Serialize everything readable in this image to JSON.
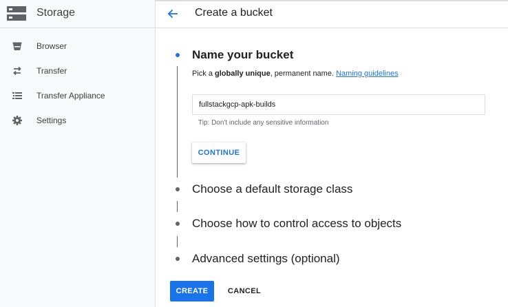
{
  "sidebar": {
    "title": "Storage",
    "items": [
      {
        "label": "Browser",
        "icon": "bucket-icon"
      },
      {
        "label": "Transfer",
        "icon": "transfer-arrows-icon"
      },
      {
        "label": "Transfer Appliance",
        "icon": "transfer-appliance-icon"
      },
      {
        "label": "Settings",
        "icon": "gear-icon"
      }
    ]
  },
  "header": {
    "title": "Create a bucket"
  },
  "steps": [
    {
      "title": "Name your bucket",
      "active": true
    },
    {
      "title": "Choose a default storage class",
      "active": false
    },
    {
      "title": "Choose how to control access to objects",
      "active": false
    },
    {
      "title": "Advanced settings (optional)",
      "active": false
    }
  ],
  "name_step": {
    "desc_prefix": "Pick a ",
    "desc_bold": "globally unique",
    "desc_suffix": ", permanent name.",
    "guidelines_link": "Naming guidelines",
    "input_value": "fullstackgcp-apk-builds",
    "tip": "Tip: Don't include any sensitive information",
    "continue_label": "CONTINUE"
  },
  "actions": {
    "create_label": "CREATE",
    "cancel_label": "CANCEL"
  },
  "colors": {
    "accent": "#1a73e8",
    "sidebar_bg": "#f8f9fa",
    "border": "#dadce0",
    "text": "#202124",
    "muted": "#5f6368"
  }
}
